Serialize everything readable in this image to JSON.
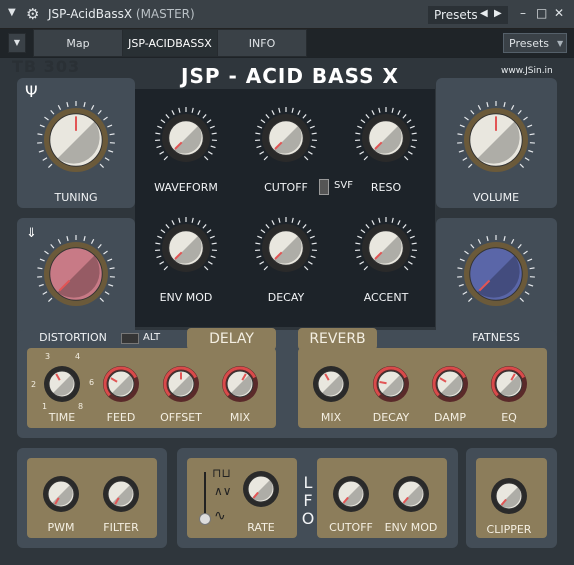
{
  "window": {
    "title": "JSP-AcidBassX",
    "subtitle": "(MASTER)",
    "presets_label": "Presets"
  },
  "tabs": [
    {
      "label": "Map",
      "active": false
    },
    {
      "label": "JSP-ACIDBASSX",
      "active": true
    },
    {
      "label": "INFO",
      "active": false
    }
  ],
  "presets_dropdown": "Presets",
  "plugin": {
    "brand": "TB 303",
    "title": "JSP - ACID BASS X",
    "url": "www.JSin.in"
  },
  "knobs_top": {
    "tuning": "TUNING",
    "waveform": "WAVEFORM",
    "cutoff": "CUTOFF",
    "svf": "SVF",
    "reso": "RESO",
    "volume": "VOLUME"
  },
  "knobs_mid": {
    "env_mod": "ENV MOD",
    "decay": "DECAY",
    "accent": "ACCENT",
    "distortion": "DISTORTION",
    "alt": "ALT",
    "fatness": "FATNESS"
  },
  "delay": {
    "title": "DELAY",
    "time": "TIME",
    "feed": "FEED",
    "offset": "OFFSET",
    "mix": "MIX",
    "time_scale": [
      "1",
      "2",
      "3",
      "4",
      "6",
      "8"
    ]
  },
  "reverb": {
    "title": "REVERB",
    "mix": "MIX",
    "decay": "DECAY",
    "damp": "DAMP",
    "eq": "EQ"
  },
  "bottom": {
    "pwm": "PWM",
    "filter": "FILTER",
    "rate": "RATE",
    "lfo": "LFO",
    "cutoff": "CUTOFF",
    "env_mod": "ENV MOD",
    "clipper": "CLIPPER"
  },
  "colors": {
    "panel": "#434d57",
    "tan": "#8c7d5b",
    "distortion_knob": "#c87a86",
    "fatness_knob": "#5a66a8",
    "indicator_red": "#e25555"
  }
}
